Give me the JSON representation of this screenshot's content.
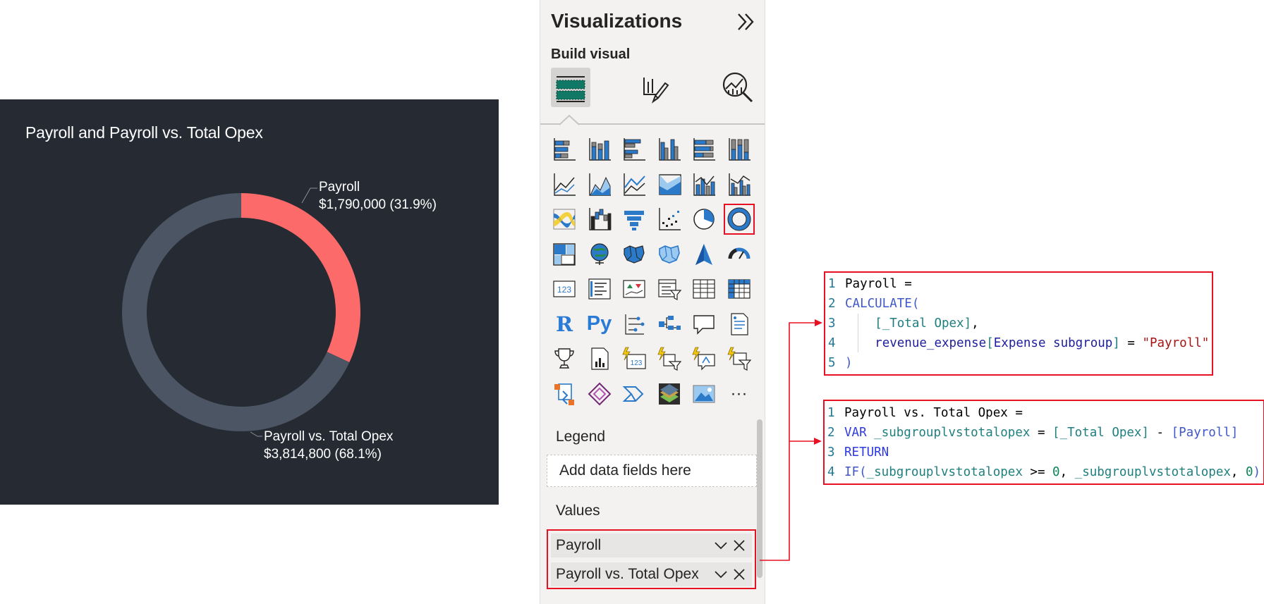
{
  "chart": {
    "title": "Payroll and Payroll vs. Total Opex",
    "slices": [
      {
        "name": "Payroll",
        "value_label": "$1,790,000 (31.9%)",
        "fraction": 0.319,
        "color": "#fd6a6a"
      },
      {
        "name": "Payroll vs. Total Opex",
        "value_label": "$3,814,800 (68.1%)",
        "fraction": 0.681,
        "color": "#4b5563"
      }
    ]
  },
  "chart_data": {
    "type": "pie",
    "title": "Payroll and Payroll vs. Total Opex",
    "categories": [
      "Payroll",
      "Payroll vs. Total Opex"
    ],
    "values": [
      1790000,
      3814800
    ],
    "percentages": [
      31.9,
      68.1
    ],
    "data_labels": [
      "$1,790,000 (31.9%)",
      "$3,814,800 (68.1%)"
    ],
    "colors": [
      "#fd6a6a",
      "#4b5563"
    ],
    "donut": true
  },
  "pane": {
    "title": "Visualizations",
    "collapse_icon": "double-chevron-right-icon",
    "build_visual_label": "Build visual",
    "modes": [
      "build-visual-icon",
      "format-visual-icon",
      "analytics-icon"
    ],
    "visual_icons": [
      "stacked-bar-chart",
      "stacked-column-chart",
      "clustered-bar-chart",
      "clustered-column-chart",
      "100-stacked-bar-chart",
      "100-stacked-column-chart",
      "line-chart",
      "area-chart",
      "stacked-area-chart",
      "100-stacked-area-chart",
      "line-and-stacked-column-chart",
      "line-and-clustered-column-chart",
      "ribbon-chart",
      "waterfall-chart",
      "funnel-chart",
      "scatter-chart",
      "pie-chart",
      "donut-chart",
      "treemap",
      "map",
      "filled-map",
      "shape-map",
      "azure-map",
      "gauge",
      "card",
      "multi-row-card",
      "kpi",
      "slicer",
      "table",
      "matrix",
      "r-visual",
      "python-visual",
      "key-influencers",
      "decomposition-tree",
      "qna",
      "smart-narrative",
      "metrics",
      "paginated-report",
      "power-automate-card",
      "power-automate-slicer",
      "power-automate-qa",
      "power-automate-filter",
      "custom-visual-1",
      "power-apps",
      "power-automate",
      "arcgis-map",
      "image-visual",
      "more-visuals"
    ],
    "r_text": "R",
    "py_text": "Py",
    "more_text": "···",
    "legend_label": "Legend",
    "legend_placeholder": "Add data fields here",
    "values_label": "Values",
    "values": [
      "Payroll",
      "Payroll vs. Total Opex"
    ]
  },
  "code1": {
    "lines": [
      {
        "n": "1",
        "tokens": [
          [
            "plain",
            "Payroll ="
          ]
        ]
      },
      {
        "n": "2",
        "tokens": [
          [
            "fn",
            "CALCULATE("
          ]
        ]
      },
      {
        "n": "3",
        "tokens": [
          [
            "plain",
            "    "
          ],
          [
            "ref",
            "[_Total Opex]"
          ],
          [
            "plain",
            ","
          ]
        ]
      },
      {
        "n": "4",
        "tokens": [
          [
            "plain",
            "    "
          ],
          [
            "col",
            "revenue_expense"
          ],
          [
            "ref",
            "["
          ],
          [
            "col",
            "Expense subgroup"
          ],
          [
            "ref",
            "]"
          ],
          [
            "plain",
            " = "
          ],
          [
            "str",
            "\"Payroll\""
          ]
        ]
      },
      {
        "n": "5",
        "tokens": [
          [
            "fn",
            ")"
          ]
        ]
      }
    ]
  },
  "code2": {
    "lines": [
      {
        "n": "1",
        "tokens": [
          [
            "plain",
            "Payroll vs. Total Opex ="
          ]
        ]
      },
      {
        "n": "2",
        "tokens": [
          [
            "kw",
            "VAR "
          ],
          [
            "ref",
            "_subgrouplvstotalopex"
          ],
          [
            "plain",
            " = "
          ],
          [
            "ref",
            "[_Total Opex]"
          ],
          [
            "plain",
            " - "
          ],
          [
            "fn",
            "[Payroll]"
          ]
        ]
      },
      {
        "n": "3",
        "tokens": [
          [
            "kw",
            "RETURN"
          ]
        ]
      },
      {
        "n": "4",
        "tokens": [
          [
            "fn",
            "IF("
          ],
          [
            "ref",
            "_subgrouplvstotalopex"
          ],
          [
            "plain",
            " >= "
          ],
          [
            "num",
            "0"
          ],
          [
            "plain",
            ", "
          ],
          [
            "ref",
            "_subgrouplvstotalopex"
          ],
          [
            "plain",
            ", "
          ],
          [
            "num",
            "0"
          ],
          [
            "fn",
            ")"
          ]
        ]
      }
    ]
  }
}
